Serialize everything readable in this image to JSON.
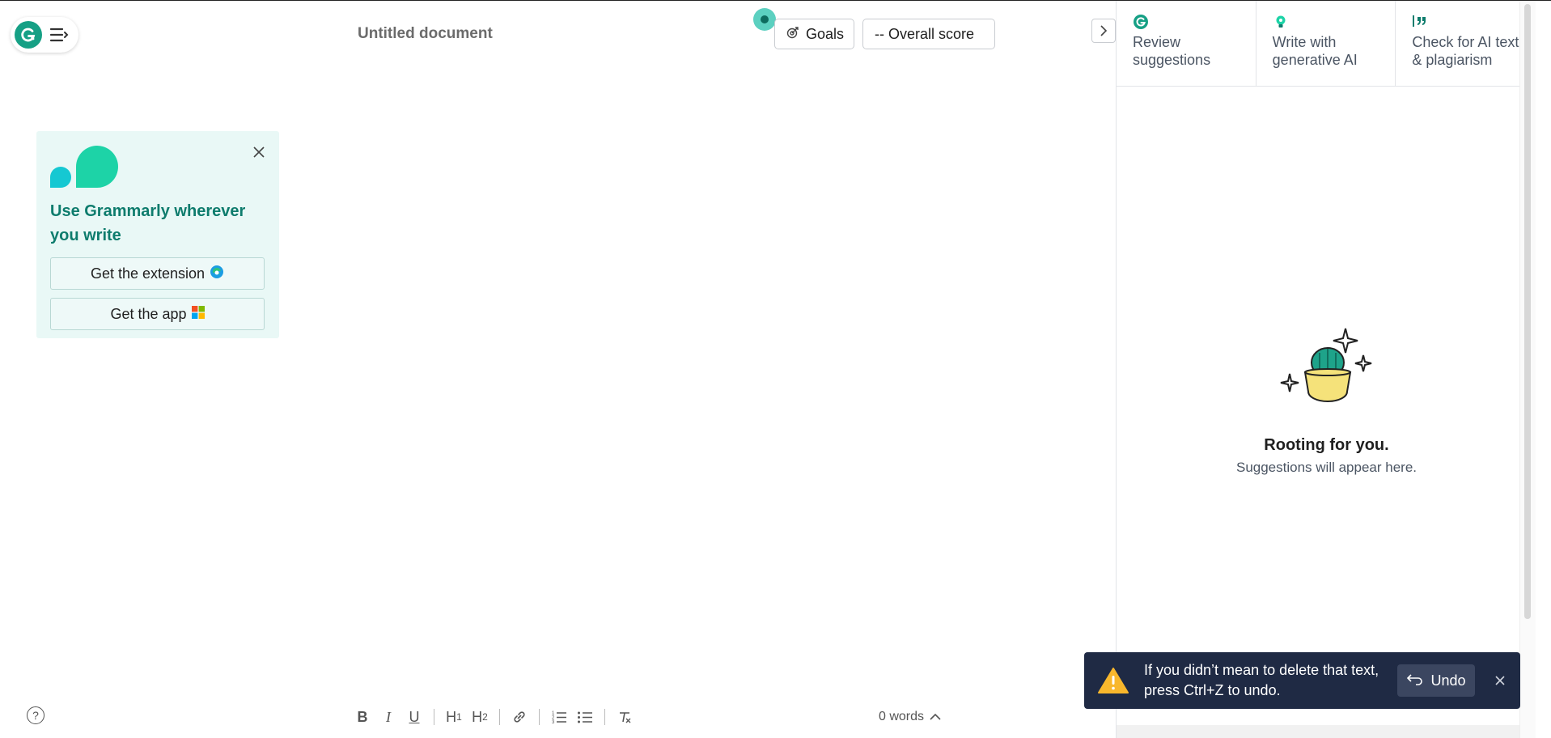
{
  "document": {
    "title": "Untitled document"
  },
  "header": {
    "goals_label": "Goals",
    "score_label": "-- Overall score"
  },
  "promo": {
    "title": "Use Grammarly wherever you write",
    "extension_label": "Get the extension",
    "app_label": "Get the app"
  },
  "panel": {
    "tabs": [
      {
        "label": "Review suggestions",
        "icon": "grammarly-g-icon"
      },
      {
        "label": "Write with generative AI",
        "icon": "lightbulb-icon"
      },
      {
        "label": "Check for AI text & plagiarism",
        "icon": "quote-icon"
      }
    ],
    "empty_title": "Rooting for you.",
    "empty_subtitle": "Suggestions will appear here."
  },
  "toast": {
    "message": "If you didn’t mean to delete that text, press Ctrl+Z to undo.",
    "undo_label": "Undo"
  },
  "toolbar": {
    "bold": "B",
    "italic": "I",
    "underline": "U",
    "h1": "H",
    "h1_sub": "1",
    "h2": "H",
    "h2_sub": "2"
  },
  "status": {
    "word_count": "0 words"
  },
  "colors": {
    "brand": "#16a085",
    "promo_bg": "#e9f8f6",
    "promo_title": "#0e7c6d",
    "toast_bg": "#1f2a44"
  }
}
